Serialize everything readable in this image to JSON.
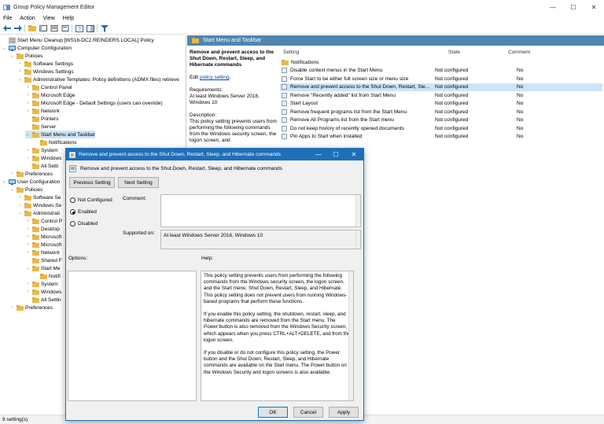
{
  "window": {
    "title": "Group Policy Management Editor",
    "controls": [
      "—",
      "☐",
      "✕"
    ]
  },
  "menu": [
    "File",
    "Action",
    "View",
    "Help"
  ],
  "tree": [
    {
      "label": "Start Menu Cleanup [WS16-DC2.REINDERS.LOCAL] Policy",
      "level": 0,
      "exp": "",
      "icon": "policy"
    },
    {
      "label": "Computer Configuration",
      "level": 0,
      "exp": "⌄",
      "icon": "computer"
    },
    {
      "label": "Policies",
      "level": 1,
      "exp": "⌄",
      "icon": "folder"
    },
    {
      "label": "Software Settings",
      "level": 2,
      "exp": "›",
      "icon": "folder"
    },
    {
      "label": "Windows Settings",
      "level": 2,
      "exp": "›",
      "icon": "folder"
    },
    {
      "label": "Administrative Templates: Policy definitions (ADMX files) retrieve",
      "level": 2,
      "exp": "⌄",
      "icon": "folder"
    },
    {
      "label": "Control Panel",
      "level": 3,
      "exp": "›",
      "icon": "folder"
    },
    {
      "label": "Microsoft Edge",
      "level": 3,
      "exp": "›",
      "icon": "folder"
    },
    {
      "label": "Microsoft Edge - Default Settings (users can override)",
      "level": 3,
      "exp": "›",
      "icon": "folder"
    },
    {
      "label": "Network",
      "level": 3,
      "exp": "›",
      "icon": "folder"
    },
    {
      "label": "Printers",
      "level": 3,
      "exp": "",
      "icon": "folder"
    },
    {
      "label": "Server",
      "level": 3,
      "exp": "",
      "icon": "folder"
    },
    {
      "label": "Start Menu and Taskbar",
      "level": 3,
      "exp": "⌄",
      "icon": "folder",
      "selected": true
    },
    {
      "label": "Notifications",
      "level": 4,
      "exp": "",
      "icon": "folder"
    },
    {
      "label": "System",
      "level": 3,
      "exp": "›",
      "icon": "folder"
    },
    {
      "label": "Windows",
      "level": 3,
      "exp": "›",
      "icon": "folder"
    },
    {
      "label": "All Setti",
      "level": 3,
      "exp": "",
      "icon": "folder"
    },
    {
      "label": "Preferences",
      "level": 1,
      "exp": "›",
      "icon": "folder"
    },
    {
      "label": "User Configuration",
      "level": 0,
      "exp": "⌄",
      "icon": "computer"
    },
    {
      "label": "Policies",
      "level": 1,
      "exp": "⌄",
      "icon": "folder"
    },
    {
      "label": "Software Se",
      "level": 2,
      "exp": "›",
      "icon": "folder"
    },
    {
      "label": "Windows Se",
      "level": 2,
      "exp": "›",
      "icon": "folder"
    },
    {
      "label": "Administrati",
      "level": 2,
      "exp": "⌄",
      "icon": "folder"
    },
    {
      "label": "Control P",
      "level": 3,
      "exp": "›",
      "icon": "folder"
    },
    {
      "label": "Desktop",
      "level": 3,
      "exp": "›",
      "icon": "folder"
    },
    {
      "label": "Microsoft",
      "level": 3,
      "exp": "›",
      "icon": "folder"
    },
    {
      "label": "Microsoft",
      "level": 3,
      "exp": "›",
      "icon": "folder"
    },
    {
      "label": "Network",
      "level": 3,
      "exp": "›",
      "icon": "folder"
    },
    {
      "label": "Shared F",
      "level": 3,
      "exp": "",
      "icon": "folder"
    },
    {
      "label": "Start Me",
      "level": 3,
      "exp": "⌄",
      "icon": "folder"
    },
    {
      "label": "Notifi",
      "level": 4,
      "exp": "",
      "icon": "folder"
    },
    {
      "label": "System",
      "level": 3,
      "exp": "›",
      "icon": "folder"
    },
    {
      "label": "Windows",
      "level": 3,
      "exp": "›",
      "icon": "folder"
    },
    {
      "label": "All Settin",
      "level": 3,
      "exp": "",
      "icon": "folder"
    },
    {
      "label": "Preferences",
      "level": 1,
      "exp": "›",
      "icon": "folder"
    }
  ],
  "right": {
    "header": "Start Menu and Taskbar",
    "desc_title": "Remove and prevent access to the Shut Down, Restart, Sleep, and Hibernate commands",
    "desc_edit_prefix": "Edit ",
    "desc_edit_link": "policy setting",
    "desc_edit_suffix": ".",
    "desc_req": "Requirements:",
    "desc_req_val": "At least Windows Server 2016, Windows 10",
    "desc_body": "Description:",
    "desc_body_val": "This policy setting prevents users from performing the following commands from the Windows security screen, the logon screen, and",
    "col_setting": "Setting",
    "col_state": "State",
    "col_comment": "Comment",
    "rows": [
      {
        "name": "Notifications",
        "state": "",
        "comment": "",
        "folder": true
      },
      {
        "name": "Disable context menus in the Start Menu",
        "state": "Not configured",
        "comment": "No"
      },
      {
        "name": "Force Start to be either full screen size or menu size",
        "state": "Not configured",
        "comment": "No"
      },
      {
        "name": "Remove and prevent access to the Shut Down, Restart, Sle...",
        "state": "Not configured",
        "comment": "No",
        "selected": true
      },
      {
        "name": "Remove \"Recently added\" list from Start Menu",
        "state": "Not configured",
        "comment": "No"
      },
      {
        "name": "Start Layout",
        "state": "Not configured",
        "comment": "No"
      },
      {
        "name": "Remove frequent programs list from the Start Menu",
        "state": "Not configured",
        "comment": "No"
      },
      {
        "name": "Remove All Programs list from the Start menu",
        "state": "Not configured",
        "comment": "No"
      },
      {
        "name": "Do not keep history of recently opened documents",
        "state": "Not configured",
        "comment": "No"
      },
      {
        "name": "Pin Apps to Start when installed",
        "state": "Not configured",
        "comment": "No"
      }
    ]
  },
  "status": "9 setting(s)",
  "dialog": {
    "title": "Remove and prevent access to the Shut Down, Restart, Sleep, and Hibernate commands",
    "subtitle": "Remove and prevent access to the Shut Down, Restart, Sleep, and Hibernate commands",
    "prev": "Previous Setting",
    "next": "Next Setting",
    "opt_not_configured": "Not Configured",
    "opt_enabled": "Enabled",
    "opt_disabled": "Disabled",
    "selected_option": "Enabled",
    "comment_label": "Comment:",
    "supported_label": "Supported on:",
    "supported_val": "At least Windows Server 2016, Windows 10",
    "options_label": "Options:",
    "help_label": "Help:",
    "help_p1": "This policy setting prevents users from performing the following commands from the Windows security screen, the logon screen, and the Start menu: Shut Down, Restart, Sleep, and Hibernate. This policy setting does not prevent users from running Windows-based programs that perform these functions.",
    "help_p2": "If you enable this policy setting, the shutdown, restart, sleep, and hibernate commands are removed from the Start menu. The Power button is also removed from the Windows Security screen, which appears when you press CTRL+ALT+DELETE, and from the logon screen.",
    "help_p3": "If you disable or do not configure this policy setting, the Power button and the Shut Down, Restart, Sleep, and Hibernate commands are available on the Start menu. The Power button on the Windows Security and logon screens is also available.",
    "ok": "OK",
    "cancel": "Cancel",
    "apply": "Apply"
  },
  "colors": {
    "accent": "#1f6fb8",
    "header": "#4e86b0",
    "selection": "#cce4f7",
    "folder": "#e8b94a"
  }
}
